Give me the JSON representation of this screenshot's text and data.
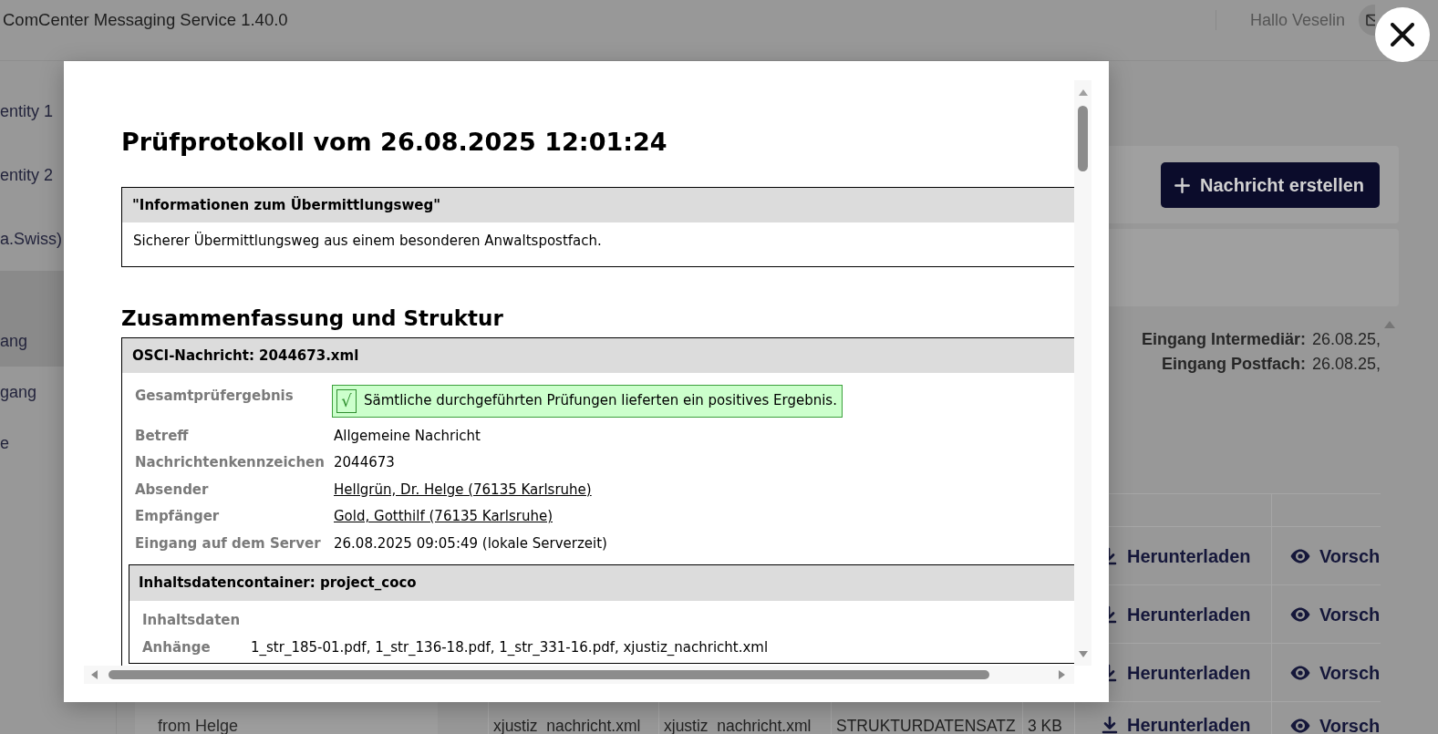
{
  "app_bar": {
    "title": "ComCenter Messaging Service 1.40.0",
    "greeting": "Hallo Veselin"
  },
  "sidebar": {
    "items": [
      {
        "kind": "account",
        "label": "entity 1",
        "selected": false
      },
      {
        "kind": "account",
        "label": "entity 2",
        "selected": false
      },
      {
        "kind": "account",
        "label": "a.Swiss)",
        "selected": false
      },
      {
        "kind": "folder",
        "label": "ang",
        "selected": true
      },
      {
        "kind": "folder",
        "label": "gang",
        "selected": false
      },
      {
        "kind": "folder",
        "label": "e",
        "selected": false
      }
    ]
  },
  "message_list": {
    "items": [
      {
        "text": "from Helge"
      }
    ]
  },
  "toolbar": {
    "create_button": "Nachricht erstellen"
  },
  "message_details": {
    "fields": [
      {
        "label": "Eingang Intermediär:",
        "value": "26.08.25,"
      },
      {
        "label": "Eingang Postfach:",
        "value": "26.08.25,"
      }
    ]
  },
  "attachments_table": {
    "rows": [
      {
        "download": "Herunterladen",
        "preview": "Vorsch"
      },
      {
        "download": "Herunterladen",
        "preview": "Vorsch"
      },
      {
        "download": "Herunterladen",
        "preview": "Vorsch"
      },
      {
        "cells": [
          "xjustiz_nachricht.xml",
          "xjustiz_nachricht.xml",
          "STRUKTURDATENSATZ",
          "3 KB"
        ],
        "download": "Herunterladen",
        "preview": "Vorsch"
      }
    ]
  },
  "dialog": {
    "title": "Prüfprotokoll vom 26.08.2025 12:01:24",
    "transmission": {
      "heading": "\"Informationen zum Übermittlungsweg\"",
      "text": "Sicherer Übermittlungsweg aus einem besonderen Anwaltspostfach."
    },
    "summary_heading": "Zusammenfassung und Struktur",
    "message": {
      "heading": "OSCI-Nachricht: 2044673.xml",
      "rows": [
        {
          "kind": "result",
          "label": "Gesamtprüfergebnis",
          "symbol": "√",
          "value": "Sämtliche durchgeführten Prüfungen lieferten ein positives Ergebnis.",
          "passed": true
        },
        {
          "kind": "text",
          "label": "Betreff",
          "value": "Allgemeine Nachricht"
        },
        {
          "kind": "text",
          "label": "Nachrichtenkennzeichen",
          "value": "2044673"
        },
        {
          "kind": "link",
          "label": "Absender",
          "value": "Hellgrün, Dr. Helge (76135 Karlsruhe)"
        },
        {
          "kind": "link",
          "label": "Empfänger",
          "value": "Gold, Gotthilf (76135 Karlsruhe)"
        },
        {
          "kind": "text",
          "label": "Eingang auf dem Server",
          "value": "26.08.2025 09:05:49 (lokale Serverzeit)"
        }
      ],
      "container": {
        "heading": "Inhaltsdatencontainer: project_coco",
        "rows": [
          {
            "kind": "text",
            "label": "Inhaltsdaten"
          },
          {
            "kind": "text",
            "label": "Anhänge",
            "value": "1_str_185-01.pdf, 1_str_136-18.pdf, 1_str_331-16.pdf, xjustiz_nachricht.xml"
          }
        ]
      }
    }
  }
}
